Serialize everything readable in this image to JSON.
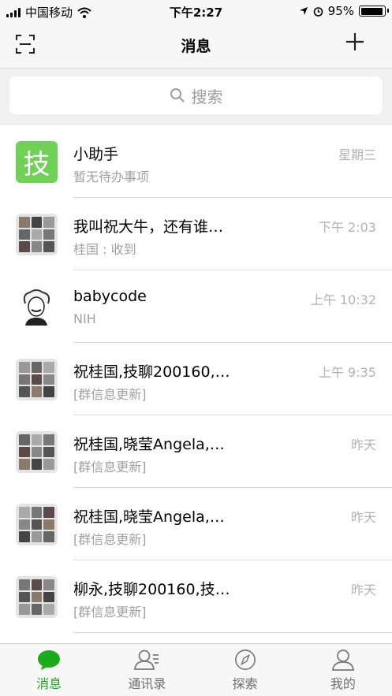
{
  "status_bar": {
    "carrier": "中国移动",
    "time": "下午2:27",
    "battery": "95%",
    "battery_level": 0.95
  },
  "nav": {
    "title": "消息"
  },
  "search": {
    "placeholder": "搜索"
  },
  "chats": [
    {
      "title": "小助手",
      "subtitle": "暂无待办事项",
      "time": "星期三",
      "avatar_text": "技",
      "avatar_type": "assistant"
    },
    {
      "title": "我叫祝大牛，还有谁…",
      "subtitle": "桂国 : 收到",
      "time": "下午 2:03",
      "avatar_type": "group"
    },
    {
      "title": "babycode",
      "subtitle": "NIH",
      "time": "上午 10:32",
      "avatar_type": "person"
    },
    {
      "title": "祝桂国,技聊200160,…",
      "subtitle": "[群信息更新]",
      "time": "上午 9:35",
      "avatar_type": "group"
    },
    {
      "title": "祝桂国,晓莹Angela,…",
      "subtitle": "[群信息更新]",
      "time": "昨天",
      "avatar_type": "group"
    },
    {
      "title": "祝桂国,晓莹Angela,…",
      "subtitle": "[群信息更新]",
      "time": "昨天",
      "avatar_type": "group"
    },
    {
      "title": "柳永,技聊200160,技…",
      "subtitle": "[群信息更新]",
      "time": "昨天",
      "avatar_type": "group"
    }
  ],
  "tabs": [
    {
      "label": "消息",
      "icon": "chat-bubble-icon",
      "active": true
    },
    {
      "label": "通讯录",
      "icon": "contacts-icon",
      "active": false
    },
    {
      "label": "探索",
      "icon": "compass-icon",
      "active": false
    },
    {
      "label": "我的",
      "icon": "person-icon",
      "active": false
    }
  ],
  "colors": {
    "accent": "#1aad19",
    "assistant_avatar": "#71d057"
  }
}
